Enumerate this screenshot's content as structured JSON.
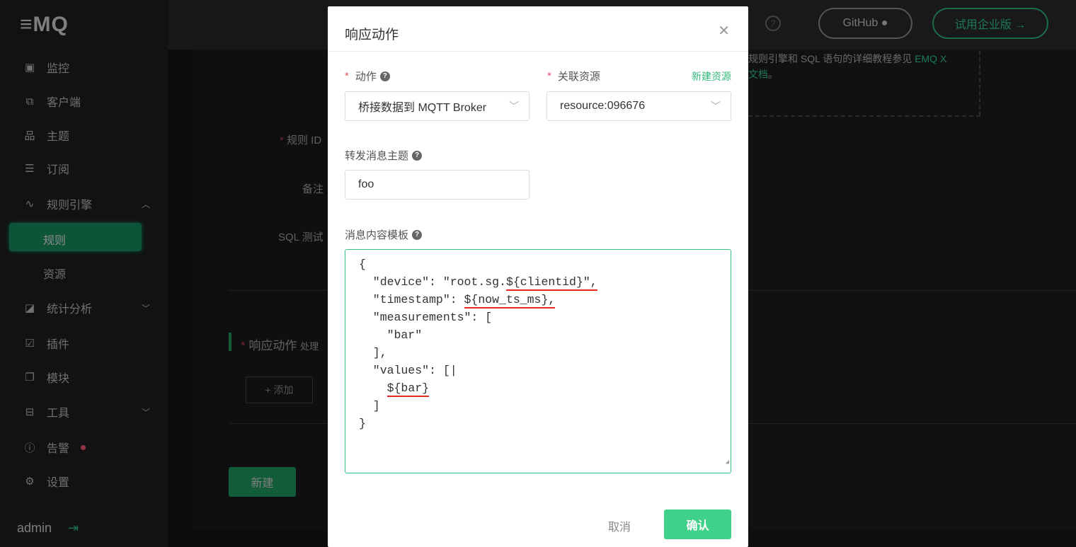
{
  "logo": "≡MQ",
  "sidebar": {
    "items": [
      {
        "label": "监控",
        "icon": "monitor-icon",
        "glyph": "▣"
      },
      {
        "label": "客户端",
        "icon": "clients-icon",
        "glyph": "⧉"
      },
      {
        "label": "主题",
        "icon": "topics-icon",
        "glyph": "品"
      },
      {
        "label": "订阅",
        "icon": "subscriptions-icon",
        "glyph": "☰"
      },
      {
        "label": "规则引擎",
        "icon": "rule-engine-icon",
        "glyph": "∿",
        "chev": "︿"
      },
      {
        "label": "统计分析",
        "icon": "analytics-icon",
        "glyph": "◪",
        "chev": "﹀"
      },
      {
        "label": "插件",
        "icon": "plugins-icon",
        "glyph": "☑"
      },
      {
        "label": "模块",
        "icon": "modules-icon",
        "glyph": "❐"
      },
      {
        "label": "工具",
        "icon": "tools-icon",
        "glyph": "⊟",
        "chev": "﹀"
      },
      {
        "label": "告警",
        "icon": "alarm-icon",
        "glyph": "ⓘ"
      },
      {
        "label": "设置",
        "icon": "settings-icon",
        "glyph": "⚙"
      }
    ],
    "sub_active": "规则",
    "sub_other": "资源",
    "user": "admin"
  },
  "header": {
    "github": "GitHub",
    "enterprise": "试用企业版 →"
  },
  "notice": {
    "text": "规则引擎和 SQL 语句的详细教程参见 ",
    "link1": "EMQ X",
    "link2": "文档",
    "end": "。"
  },
  "form": {
    "rule_id": "规则 ID",
    "note": "备注",
    "sql_test": "SQL 测试",
    "actions": "响应动作",
    "actions_hint": "处理",
    "add": "+ 添加",
    "create": "新建"
  },
  "modal": {
    "title": "响应动作",
    "action_label": "动作",
    "action_value": "桥接数据到 MQTT Broker",
    "resource_label": "关联资源",
    "new_resource": "新建资源",
    "resource_value": "resource:096676",
    "topic_label": "转发消息主题",
    "topic_value": "foo",
    "template_label": "消息内容模板",
    "template_lines": [
      [
        "{"
      ],
      [
        "  \"device\": \"root.sg.",
        "${clientid}\","
      ],
      [
        "  \"timestamp\": ",
        "${now_ts_ms},"
      ],
      [
        "  \"measurements\": ["
      ],
      [
        "    \"bar\""
      ],
      [
        "  ],"
      ],
      [
        "  \"values\": [|"
      ],
      [
        "    ",
        "${bar}"
      ],
      [
        "  ]"
      ],
      [
        "}"
      ]
    ],
    "cancel": "取消",
    "confirm": "确认"
  },
  "colors": {
    "accent": "#3fd08a",
    "underline": "#e02a1e"
  }
}
